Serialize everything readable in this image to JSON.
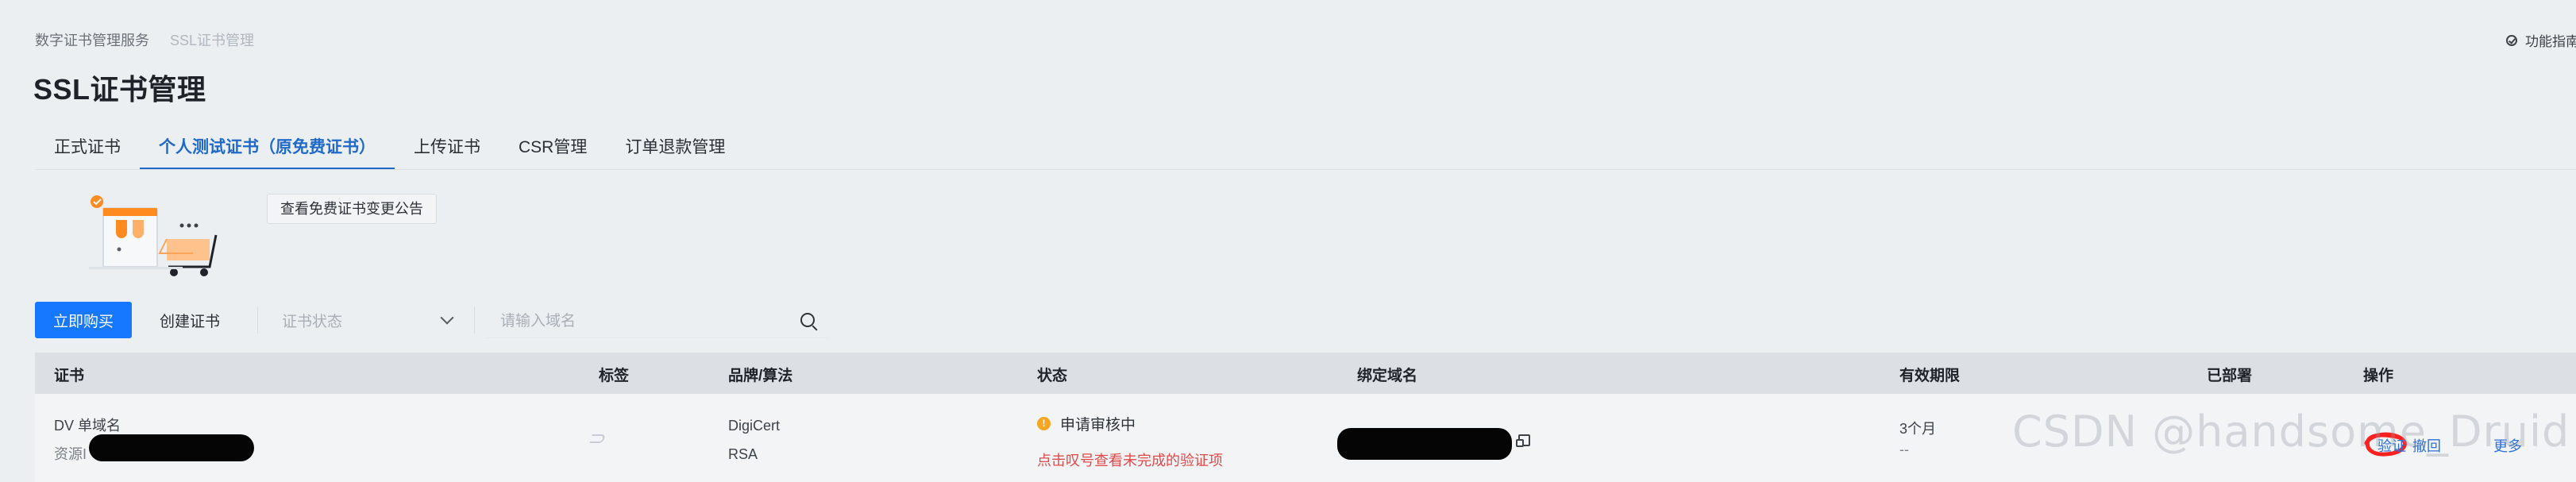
{
  "breadcrumb": {
    "items": [
      "数字证书管理服务",
      "SSL证书管理"
    ]
  },
  "header": {
    "guide_label": "功能指南",
    "title": "SSL证书管理"
  },
  "tabs": [
    {
      "label": "正式证书",
      "active": false
    },
    {
      "label": "个人测试证书（原免费证书）",
      "active": true
    },
    {
      "label": "上传证书",
      "active": false
    },
    {
      "label": "CSR管理",
      "active": false
    },
    {
      "label": "订单退款管理",
      "active": false
    }
  ],
  "notice_button": "查看免费证书变更公告",
  "toolbar": {
    "buy_label": "立即购买",
    "create_label": "创建证书",
    "status_placeholder": "证书状态",
    "search_placeholder": "请输入域名"
  },
  "table": {
    "columns": [
      "证书",
      "标签",
      "品牌/算法",
      "状态",
      "绑定域名",
      "有效期限",
      "已部署",
      "操作"
    ],
    "row": {
      "certificate_type": "DV 单域名",
      "resource_prefix": "资源I",
      "brand": "DigiCert",
      "algorithm": "RSA",
      "status": "申请审核中",
      "status_link": "点击叹号查看未完成的验证项",
      "validity": "3个月",
      "validity_detail": "--",
      "ops": [
        "验证",
        "撤回",
        "更多"
      ]
    }
  },
  "watermark": "CSDN @handsome_Druid",
  "colors": {
    "accent": "#1677ff",
    "tab_active": "#1f69c9",
    "warning": "#f5a623",
    "danger": "#e24a4a"
  },
  "icons": {
    "guide": "check-circle-icon",
    "dropdown": "chevron-down-icon",
    "search": "search-icon",
    "copy": "copy-icon",
    "tag": "tag-icon",
    "warning": "warning-icon"
  }
}
